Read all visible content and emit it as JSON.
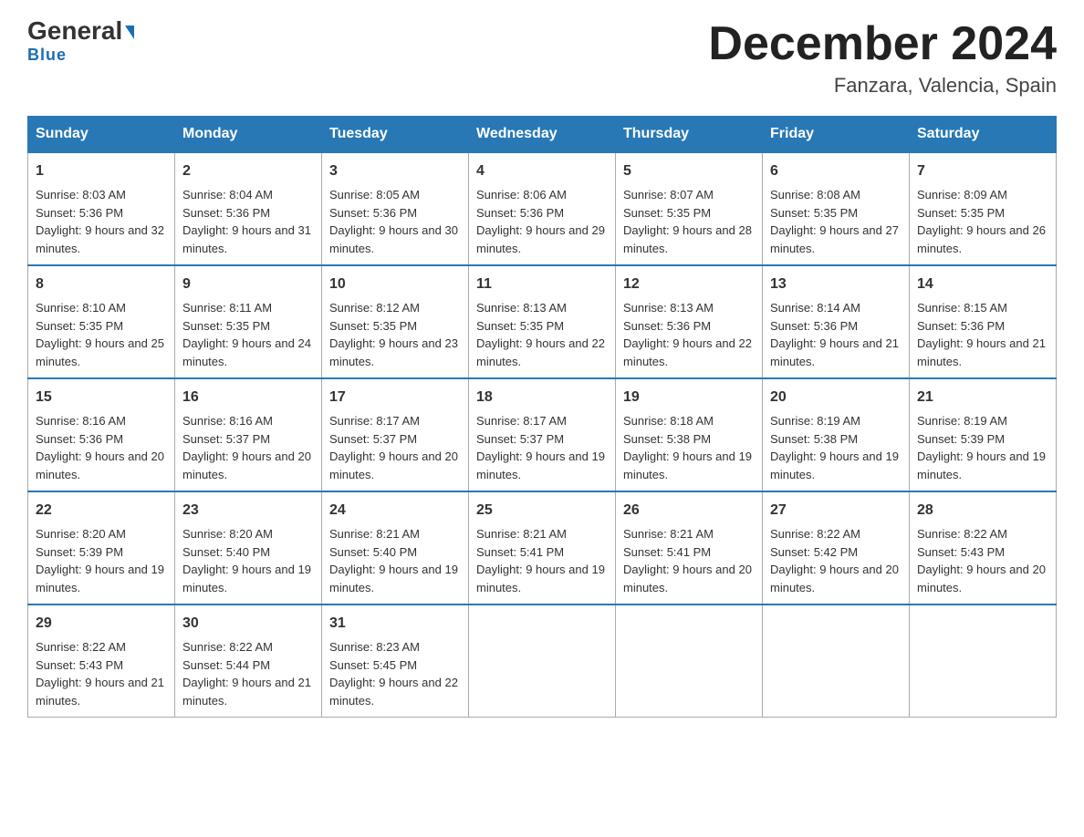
{
  "logo": {
    "general": "General",
    "blue": "Blue",
    "triangle": "▶"
  },
  "title": "December 2024",
  "subtitle": "Fanzara, Valencia, Spain",
  "days_of_week": [
    "Sunday",
    "Monday",
    "Tuesday",
    "Wednesday",
    "Thursday",
    "Friday",
    "Saturday"
  ],
  "weeks": [
    [
      {
        "day": "1",
        "sunrise": "8:03 AM",
        "sunset": "5:36 PM",
        "daylight": "9 hours and 32 minutes."
      },
      {
        "day": "2",
        "sunrise": "8:04 AM",
        "sunset": "5:36 PM",
        "daylight": "9 hours and 31 minutes."
      },
      {
        "day": "3",
        "sunrise": "8:05 AM",
        "sunset": "5:36 PM",
        "daylight": "9 hours and 30 minutes."
      },
      {
        "day": "4",
        "sunrise": "8:06 AM",
        "sunset": "5:36 PM",
        "daylight": "9 hours and 29 minutes."
      },
      {
        "day": "5",
        "sunrise": "8:07 AM",
        "sunset": "5:35 PM",
        "daylight": "9 hours and 28 minutes."
      },
      {
        "day": "6",
        "sunrise": "8:08 AM",
        "sunset": "5:35 PM",
        "daylight": "9 hours and 27 minutes."
      },
      {
        "day": "7",
        "sunrise": "8:09 AM",
        "sunset": "5:35 PM",
        "daylight": "9 hours and 26 minutes."
      }
    ],
    [
      {
        "day": "8",
        "sunrise": "8:10 AM",
        "sunset": "5:35 PM",
        "daylight": "9 hours and 25 minutes."
      },
      {
        "day": "9",
        "sunrise": "8:11 AM",
        "sunset": "5:35 PM",
        "daylight": "9 hours and 24 minutes."
      },
      {
        "day": "10",
        "sunrise": "8:12 AM",
        "sunset": "5:35 PM",
        "daylight": "9 hours and 23 minutes."
      },
      {
        "day": "11",
        "sunrise": "8:13 AM",
        "sunset": "5:35 PM",
        "daylight": "9 hours and 22 minutes."
      },
      {
        "day": "12",
        "sunrise": "8:13 AM",
        "sunset": "5:36 PM",
        "daylight": "9 hours and 22 minutes."
      },
      {
        "day": "13",
        "sunrise": "8:14 AM",
        "sunset": "5:36 PM",
        "daylight": "9 hours and 21 minutes."
      },
      {
        "day": "14",
        "sunrise": "8:15 AM",
        "sunset": "5:36 PM",
        "daylight": "9 hours and 21 minutes."
      }
    ],
    [
      {
        "day": "15",
        "sunrise": "8:16 AM",
        "sunset": "5:36 PM",
        "daylight": "9 hours and 20 minutes."
      },
      {
        "day": "16",
        "sunrise": "8:16 AM",
        "sunset": "5:37 PM",
        "daylight": "9 hours and 20 minutes."
      },
      {
        "day": "17",
        "sunrise": "8:17 AM",
        "sunset": "5:37 PM",
        "daylight": "9 hours and 20 minutes."
      },
      {
        "day": "18",
        "sunrise": "8:17 AM",
        "sunset": "5:37 PM",
        "daylight": "9 hours and 19 minutes."
      },
      {
        "day": "19",
        "sunrise": "8:18 AM",
        "sunset": "5:38 PM",
        "daylight": "9 hours and 19 minutes."
      },
      {
        "day": "20",
        "sunrise": "8:19 AM",
        "sunset": "5:38 PM",
        "daylight": "9 hours and 19 minutes."
      },
      {
        "day": "21",
        "sunrise": "8:19 AM",
        "sunset": "5:39 PM",
        "daylight": "9 hours and 19 minutes."
      }
    ],
    [
      {
        "day": "22",
        "sunrise": "8:20 AM",
        "sunset": "5:39 PM",
        "daylight": "9 hours and 19 minutes."
      },
      {
        "day": "23",
        "sunrise": "8:20 AM",
        "sunset": "5:40 PM",
        "daylight": "9 hours and 19 minutes."
      },
      {
        "day": "24",
        "sunrise": "8:21 AM",
        "sunset": "5:40 PM",
        "daylight": "9 hours and 19 minutes."
      },
      {
        "day": "25",
        "sunrise": "8:21 AM",
        "sunset": "5:41 PM",
        "daylight": "9 hours and 19 minutes."
      },
      {
        "day": "26",
        "sunrise": "8:21 AM",
        "sunset": "5:41 PM",
        "daylight": "9 hours and 20 minutes."
      },
      {
        "day": "27",
        "sunrise": "8:22 AM",
        "sunset": "5:42 PM",
        "daylight": "9 hours and 20 minutes."
      },
      {
        "day": "28",
        "sunrise": "8:22 AM",
        "sunset": "5:43 PM",
        "daylight": "9 hours and 20 minutes."
      }
    ],
    [
      {
        "day": "29",
        "sunrise": "8:22 AM",
        "sunset": "5:43 PM",
        "daylight": "9 hours and 21 minutes."
      },
      {
        "day": "30",
        "sunrise": "8:22 AM",
        "sunset": "5:44 PM",
        "daylight": "9 hours and 21 minutes."
      },
      {
        "day": "31",
        "sunrise": "8:23 AM",
        "sunset": "5:45 PM",
        "daylight": "9 hours and 22 minutes."
      },
      null,
      null,
      null,
      null
    ]
  ],
  "labels": {
    "sunrise": "Sunrise:",
    "sunset": "Sunset:",
    "daylight": "Daylight:"
  }
}
